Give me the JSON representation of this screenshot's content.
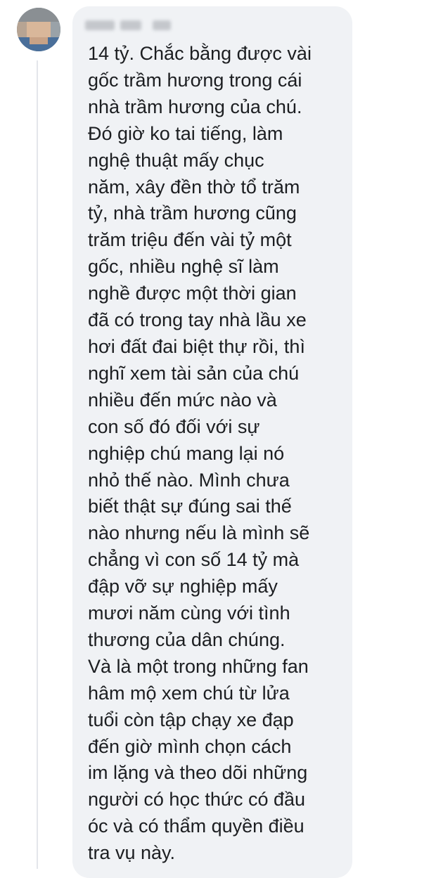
{
  "comment": {
    "author_name": "",
    "lines": [
      "14 tỷ. Chắc bằng được vài",
      "gốc trầm hương trong cái",
      "nhà trầm hương của chú.",
      "Đó giờ ko tai tiếng, làm",
      "nghệ thuật mấy chục",
      "năm, xây đền thờ tổ trăm",
      "tỷ, nhà trầm hương cũng",
      "trăm triệu đến vài tỷ một",
      "gốc, nhiều nghệ sĩ làm",
      "nghề được một thời gian",
      "đã có trong tay nhà lầu xe",
      "hơi đất đai biệt thự rồi, thì",
      "nghĩ xem tài sản của chú",
      "nhiều đến mức nào và",
      "con số đó đối với sự",
      "nghiệp chú mang lại nó",
      "nhỏ thế nào. Mình chưa",
      "biết thật sự đúng sai thế",
      "nào nhưng nếu là mình sẽ",
      "chẳng vì con số 14 tỷ mà",
      "đập vỡ sự nghiệp mấy",
      "mươi năm cùng với tình",
      "thương của dân chúng.",
      "Và là một trong những fan",
      "hâm mộ xem chú từ lửa",
      "tuổi còn tập chạy xe đạp",
      "đến giờ mình chọn cách",
      "im lặng và theo dõi những",
      "người có học thức có đầu",
      "óc và có thẩm quyền điều",
      "tra vụ này."
    ]
  },
  "colors": {
    "bubble": "#f0f2f5",
    "text": "#1c1e21",
    "thread_line": "#e4e6eb"
  }
}
